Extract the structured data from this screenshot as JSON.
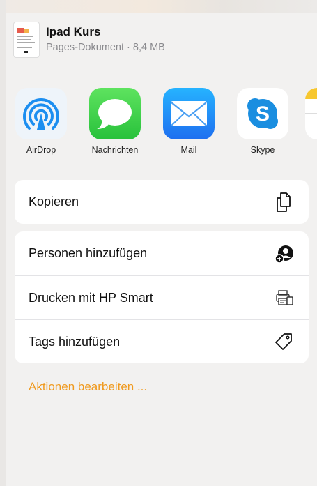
{
  "document": {
    "title": "Ipad Kurs",
    "subtitle": "Pages-Dokument · 8,4 MB"
  },
  "apps": [
    {
      "label": "AirDrop",
      "icon": "airdrop-icon"
    },
    {
      "label": "Nachrichten",
      "icon": "messages-icon"
    },
    {
      "label": "Mail",
      "icon": "mail-icon"
    },
    {
      "label": "Skype",
      "icon": "skype-icon"
    },
    {
      "label": "",
      "icon": "notes-icon"
    }
  ],
  "actions_primary": [
    {
      "label": "Kopieren",
      "icon": "copy-icon"
    }
  ],
  "actions_secondary": [
    {
      "label": "Personen hinzufügen",
      "icon": "add-person-icon"
    },
    {
      "label": "Drucken mit HP Smart",
      "icon": "hp-print-icon"
    },
    {
      "label": "Tags hinzufügen",
      "icon": "tag-icon"
    }
  ],
  "edit_actions": "Aktionen bearbeiten ...",
  "colors": {
    "accent": "#f09a1f",
    "messages_green": "#34c759",
    "mail_blue": "#1e88f5",
    "skype_blue": "#1a8ee0",
    "airdrop_blue": "#1c8ef0"
  }
}
